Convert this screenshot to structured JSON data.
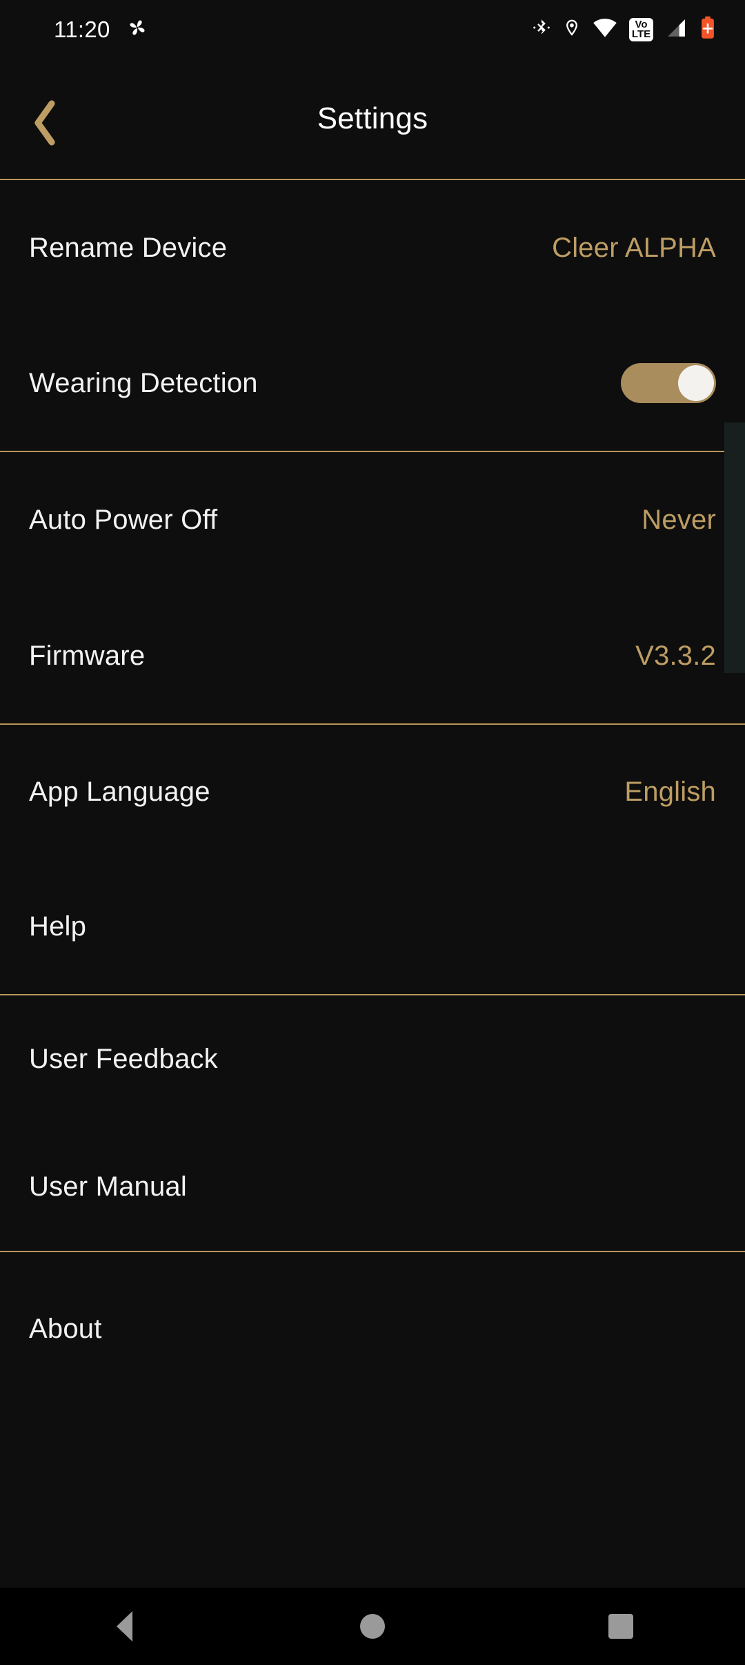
{
  "statusbar": {
    "time": "11:20",
    "left_icons": [
      {
        "name": "pinwheel-app-icon",
        "glyph": "pinwheel"
      }
    ],
    "right_icons": [
      {
        "name": "bluetooth-icon",
        "glyph": "bluetooth"
      },
      {
        "name": "location-icon",
        "glyph": "location-pin"
      },
      {
        "name": "wifi-icon",
        "glyph": "wifi"
      },
      {
        "name": "volte-icon",
        "line1": "Vo",
        "line2": "LTE"
      },
      {
        "name": "cellular-signal-icon",
        "glyph": "signal-bars"
      },
      {
        "name": "battery-saver-icon",
        "glyph": "battery-plus",
        "color": "#f4542a"
      }
    ]
  },
  "header": {
    "back_label": "Back",
    "title": "Settings"
  },
  "theme": {
    "accent": "#bd9d63",
    "divider": "#b9985c",
    "background": "#0e0e0e",
    "label": "#f2f2f2",
    "toggle_on_track": "#a98d5d",
    "toggle_knob": "#f4f2ef",
    "navbar_icon": "#9a9a9a",
    "edge_band": "#17201f"
  },
  "sections": [
    {
      "name": "device-section",
      "rows": [
        {
          "name": "rename-device",
          "label": "Rename Device",
          "value": "Cleer ALPHA",
          "type": "value"
        },
        {
          "name": "wearing-detection",
          "label": "Wearing Detection",
          "value": "",
          "type": "toggle",
          "toggle_on": true
        }
      ]
    },
    {
      "name": "power-section",
      "rows": [
        {
          "name": "auto-power-off",
          "label": "Auto Power Off",
          "value": "Never",
          "type": "value"
        },
        {
          "name": "firmware",
          "label": "Firmware",
          "value": "V3.3.2",
          "type": "value"
        }
      ]
    },
    {
      "name": "app-section",
      "rows": [
        {
          "name": "app-language",
          "label": "App Language",
          "value": "English",
          "type": "value"
        },
        {
          "name": "help",
          "label": "Help",
          "value": "",
          "type": "plain"
        }
      ]
    },
    {
      "name": "support-section",
      "rows": [
        {
          "name": "user-feedback",
          "label": "User Feedback",
          "value": "",
          "type": "plain"
        },
        {
          "name": "user-manual",
          "label": "User Manual",
          "value": "",
          "type": "plain"
        }
      ]
    },
    {
      "name": "about-section",
      "rows": [
        {
          "name": "about",
          "label": "About",
          "value": "",
          "type": "plain"
        }
      ]
    }
  ],
  "navbar": {
    "back_label": "Back",
    "home_label": "Home",
    "recents_label": "Recents"
  }
}
